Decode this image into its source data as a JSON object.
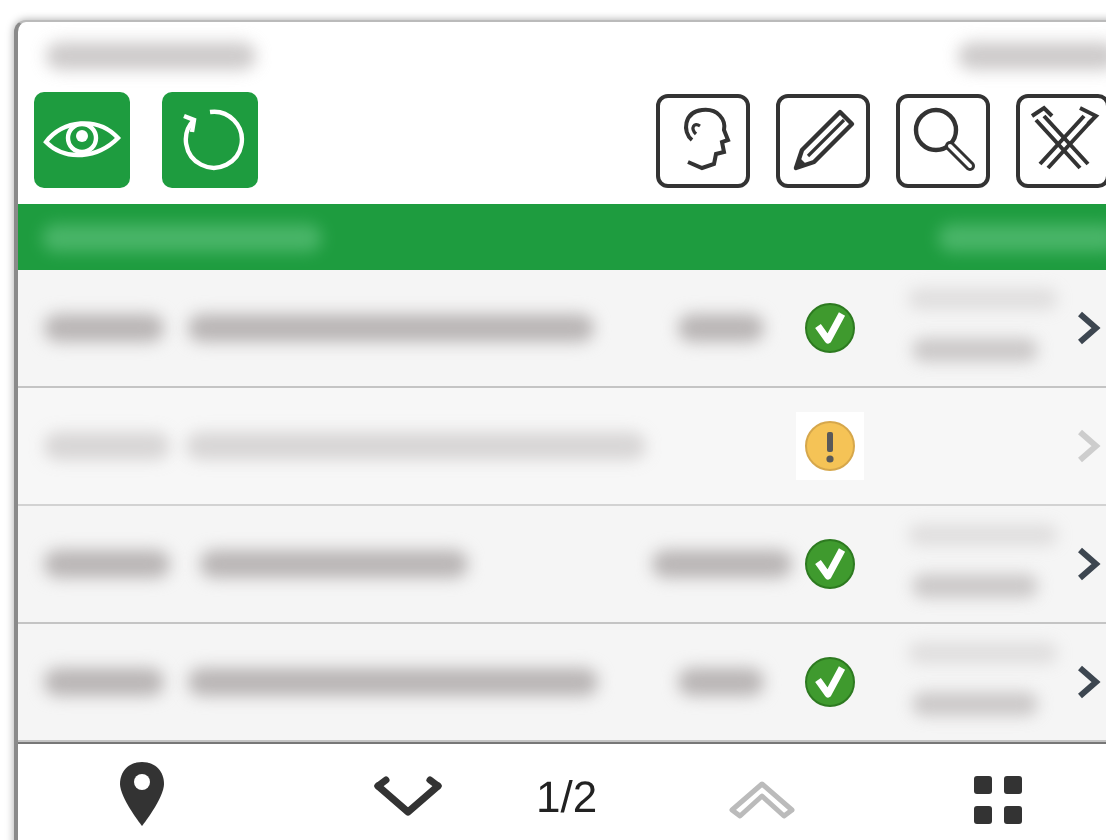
{
  "rows": [
    {
      "kind": "ok",
      "disabled": false
    },
    {
      "kind": "warning",
      "disabled": true
    },
    {
      "kind": "ok",
      "disabled": false
    },
    {
      "kind": "ok",
      "disabled": false
    }
  ],
  "pager": {
    "page": "1/2",
    "down_disabled": false,
    "up_disabled": true
  }
}
